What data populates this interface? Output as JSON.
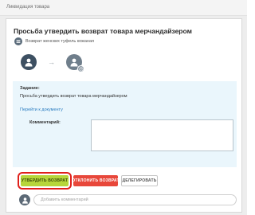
{
  "window": {
    "title": "Ликвидация товара"
  },
  "task": {
    "title": "Просьба утвердить возврат товара мерчандайзером",
    "process_label": "Возврат женских туфель кожаная"
  },
  "details": {
    "task_label": "Задание:",
    "task_text": "Просьба утвердить возврат товара мерчандайзером",
    "doc_link": "Перейти к документу",
    "comment_label": "Комментарий:",
    "comment_value": ""
  },
  "actions": {
    "approve_label": "утвердить возврат",
    "reject_label": "отклонить возврат",
    "delegate_label": "делегировать"
  },
  "comment_bar": {
    "placeholder": "Добавить комментарий"
  },
  "colors": {
    "approve": "#b7d63b",
    "reject": "#e8473a",
    "highlight": "#e0201b",
    "task_box_bg": "#eaf6fc",
    "link": "#2a7cc0"
  }
}
